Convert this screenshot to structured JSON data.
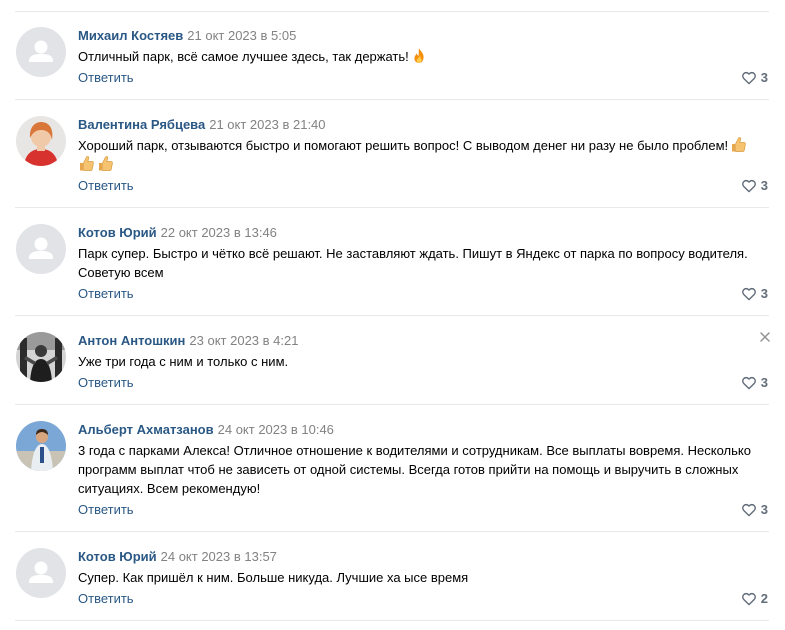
{
  "comments": [
    {
      "author": "Михаил Костяев",
      "date": "21 окт 2023 в 5:05",
      "text": "Отличный парк, всё самое лучшее здесь, так держать!",
      "emoji": [
        "fire-emoji"
      ],
      "reply_label": "Ответить",
      "likes": "3",
      "avatar": "default-avatar"
    },
    {
      "author": "Валентина Рябцева",
      "date": "21 окт 2023 в 21:40",
      "text": "Хороший парк, отзываются быстро и помогают решить вопрос! С выводом денег ни разу не было проблем!",
      "emoji": [
        "thumbs-up-emoji",
        "thumbs-up-emoji",
        "thumbs-up-emoji"
      ],
      "reply_label": "Ответить",
      "likes": "3",
      "avatar": "photo-avatar"
    },
    {
      "author": "Котов Юрий",
      "date": "22 окт 2023 в 13:46",
      "text": "Парк супер. Быстро и чётко всё решают. Не заставляют ждать. Пишут в Яндекс от парка по вопросу водителя. Советую всем",
      "emoji": [],
      "reply_label": "Ответить",
      "likes": "3",
      "avatar": "default-avatar"
    },
    {
      "author": "Антон Антошкин",
      "date": "23 окт 2023 в 4:21",
      "text": "Уже три года с ним и только с ним.",
      "emoji": [],
      "reply_label": "Ответить",
      "likes": "3",
      "avatar": "photo-avatar"
    },
    {
      "author": "Альберт Ахматзанов",
      "date": "24 окт 2023 в 10:46",
      "text": "3 года с парками Алекса! Отличное отношение к водителями и сотрудникам. Все выплаты вовремя. Несколько программ выплат чтоб не зависеть от одной системы. Всегда готов прийти на помощь и выручить в сложных ситуациях. Всем рекомендую!",
      "emoji": [],
      "reply_label": "Ответить",
      "likes": "3",
      "avatar": "photo-avatar"
    },
    {
      "author": "Котов Юрий",
      "date": "24 окт 2023 в 13:57",
      "text": "Супер. Как пришёл к ним. Больше никуда. Лучшие ха ысе время",
      "emoji": [],
      "reply_label": "Ответить",
      "likes": "2",
      "avatar": "default-avatar"
    }
  ],
  "colors": {
    "link": "#2a5885",
    "date": "#828282",
    "divider": "#e7e8ec",
    "like": "#626d7a",
    "avatar_bg": "#e1e3e6",
    "avatar_fg": "#ffffff"
  }
}
